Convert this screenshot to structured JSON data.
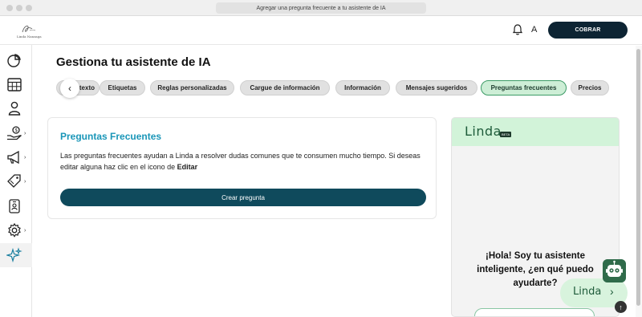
{
  "browser": {
    "title": "Agregar una pregunta frecuente a tu asistente de IA"
  },
  "header": {
    "logo_text": "Linda Nanzaga",
    "avatar_initial": "A",
    "cobrar_label": "COBRAR"
  },
  "sidebar": {
    "items": [
      {
        "icon": "pie-chart-icon"
      },
      {
        "icon": "calendar-icon"
      },
      {
        "icon": "user-icon"
      },
      {
        "icon": "money-hand-icon",
        "has_submenu": true
      },
      {
        "icon": "megaphone-icon",
        "has_submenu": true
      },
      {
        "icon": "tag-icon",
        "has_submenu": true
      },
      {
        "icon": "id-badge-icon"
      },
      {
        "icon": "gear-icon",
        "has_submenu": true
      },
      {
        "icon": "sparkles-icon",
        "active": true
      }
    ],
    "chevron": "›"
  },
  "main": {
    "title": "Gestiona tu asistente de IA",
    "tabs": [
      {
        "label": "contexto"
      },
      {
        "label": "Etiquetas"
      },
      {
        "label": "Reglas personalizadas"
      },
      {
        "label": "Cargue de información"
      },
      {
        "label": "Información"
      },
      {
        "label": "Mensajes sugeridos"
      },
      {
        "label": "Preguntas frecuentes",
        "active": true
      },
      {
        "label": "Precios"
      }
    ],
    "tab_prev_arrow": "‹"
  },
  "faq": {
    "title": "Preguntas Frecuentes",
    "description_part1": "Las preguntas frecuentes ayudan a Linda a resolver dudas comunes que te consumen mucho tiempo. Si deseas editar alguna haz clic en el icono de ",
    "description_bold": "Editar",
    "create_button": "Crear pregunta"
  },
  "chat": {
    "brand": "Linda",
    "badge": "BETA",
    "greeting": "¡Hola! Soy tu asistente inteligente, ¿en qué puedo ayudarte?"
  },
  "floating": {
    "label": "Linda",
    "arrow": "›",
    "scroll_top": "↑"
  },
  "colors": {
    "primary_dark": "#0d2433",
    "button_teal": "#0f4a5c",
    "faq_title": "#1a96b8",
    "active_tab_bg": "#cdeed6",
    "linda_green": "#1e5b3a"
  }
}
